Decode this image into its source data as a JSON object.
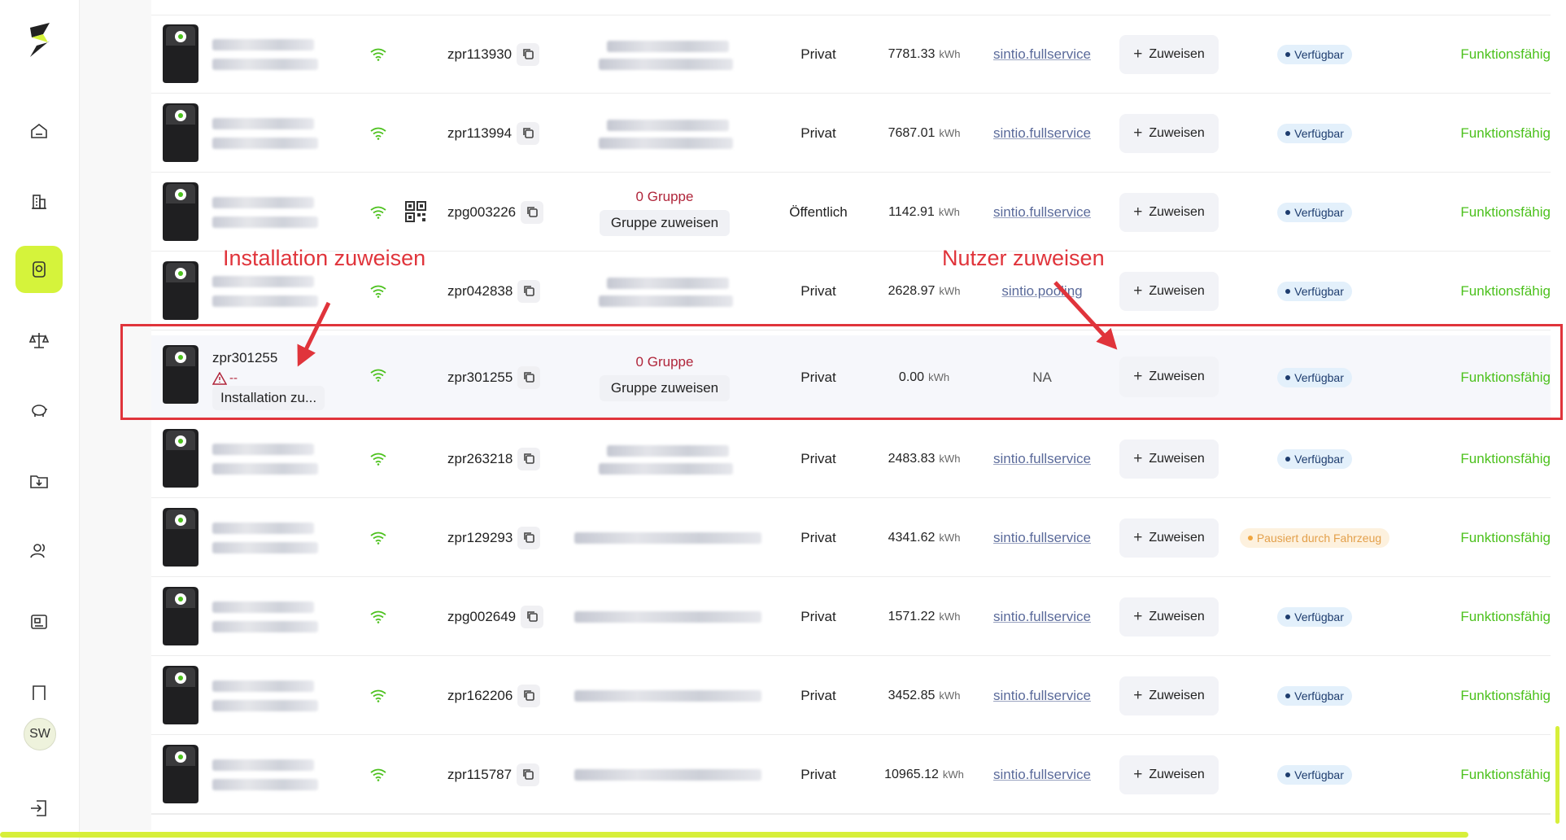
{
  "sidebar": {
    "items": [
      {
        "name": "home"
      },
      {
        "name": "buildings"
      },
      {
        "name": "charger",
        "active": true
      },
      {
        "name": "balance"
      },
      {
        "name": "piggy-bank"
      },
      {
        "name": "folder-download"
      },
      {
        "name": "users"
      },
      {
        "name": "id-card"
      },
      {
        "name": "bookmark"
      }
    ],
    "avatar": "SW",
    "accent": "#d5f33b"
  },
  "rows": [
    {
      "serial": "zpr113930",
      "type": "Privat",
      "energy": "7781.33",
      "unit": "kWh",
      "user": "sintio.fullservice",
      "assign": "Zuweisen",
      "status": "Verfügbar",
      "status_kind": "ok",
      "func": "Funktionsfähig"
    },
    {
      "serial": "zpr113994",
      "type": "Privat",
      "energy": "7687.01",
      "unit": "kWh",
      "user": "sintio.fullservice",
      "assign": "Zuweisen",
      "status": "Verfügbar",
      "status_kind": "ok",
      "func": "Funktionsfähig"
    },
    {
      "serial": "zpg003226",
      "type": "Öffentlich",
      "energy": "1142.91",
      "unit": "kWh",
      "user": "sintio.fullservice",
      "assign": "Zuweisen",
      "status": "Verfügbar",
      "status_kind": "ok",
      "func": "Funktionsfähig",
      "group_count": "0 Gruppe",
      "group_btn": "Gruppe zuweisen"
    },
    {
      "serial": "zpr042838",
      "type": "Privat",
      "energy": "2628.97",
      "unit": "kWh",
      "user": "sintio.pooling",
      "assign": "Zuweisen",
      "status": "Verfügbar",
      "status_kind": "ok",
      "func": "Funktionsfähig"
    },
    {
      "serial": "zpr301255",
      "name": "zpr301255",
      "warn": "--",
      "install_btn": "Installation zu...",
      "type": "Privat",
      "energy": "0.00",
      "unit": "kWh",
      "user": "NA",
      "assign": "Zuweisen",
      "status": "Verfügbar",
      "status_kind": "ok",
      "func": "Funktionsfähig",
      "group_count": "0 Gruppe",
      "group_btn": "Gruppe zuweisen"
    },
    {
      "serial": "zpr263218",
      "type": "Privat",
      "energy": "2483.83",
      "unit": "kWh",
      "user": "sintio.fullservice",
      "assign": "Zuweisen",
      "status": "Verfügbar",
      "status_kind": "ok",
      "func": "Funktionsfähig"
    },
    {
      "serial": "zpr129293",
      "type": "Privat",
      "energy": "4341.62",
      "unit": "kWh",
      "user": "sintio.fullservice",
      "assign": "Zuweisen",
      "status": "Pausiert durch Fahrzeug",
      "status_kind": "paused",
      "func": "Funktionsfähig"
    },
    {
      "serial": "zpg002649",
      "type": "Privat",
      "energy": "1571.22",
      "unit": "kWh",
      "user": "sintio.fullservice",
      "assign": "Zuweisen",
      "status": "Verfügbar",
      "status_kind": "ok",
      "func": "Funktionsfähig"
    },
    {
      "serial": "zpr162206",
      "type": "Privat",
      "energy": "3452.85",
      "unit": "kWh",
      "user": "sintio.fullservice",
      "assign": "Zuweisen",
      "status": "Verfügbar",
      "status_kind": "ok",
      "func": "Funktionsfähig"
    },
    {
      "serial": "zpr115787",
      "type": "Privat",
      "energy": "10965.12",
      "unit": "kWh",
      "user": "sintio.fullservice",
      "assign": "Zuweisen",
      "status": "Verfügbar",
      "status_kind": "ok",
      "func": "Funktionsfähig"
    }
  ],
  "annotations": {
    "left": "Installation zuweisen",
    "right": "Nutzer zuweisen",
    "color": "#e0343b"
  },
  "colors": {
    "func_green": "#4cc11d",
    "group_red": "#b0253a"
  }
}
